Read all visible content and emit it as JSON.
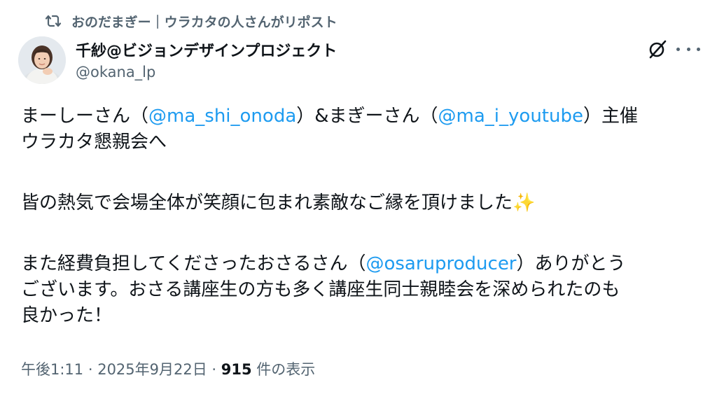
{
  "repost": {
    "text": "おのだまぎー｜ウラカタの人さんがリポスト"
  },
  "author": {
    "display_name": "千紗@ビジョンデザインプロジェクト",
    "handle": "@okana_lp"
  },
  "body": {
    "l1a": "まーしーさん（",
    "l1_mention1": "@ma_shi_onoda",
    "l1b": "）&まぎーさん（",
    "l1_mention2": "@ma_i_youtube",
    "l1c": "）主催",
    "l2": "ウラカタ懇親会へ",
    "l3": "皆の熱気で会場全体が笑顔に包まれ素敵なご縁を頂けました✨",
    "l4a": "また経費負担してくださったおさるさん（",
    "l4_mention": "@osaruproducer",
    "l4b": "）ありがとう",
    "l5": "ございます。おさる講座生の方も多く講座生同士親睦会を深められたのも",
    "l6": "良かった！"
  },
  "meta": {
    "time": "午後1:11",
    "sep1": " · ",
    "date": "2025年9月22日",
    "sep2": " · ",
    "views": "915",
    "views_label": " 件の表示"
  },
  "colors": {
    "mention": "#1d9bf0",
    "secondary": "#536471",
    "primary_text": "#0f1419"
  },
  "icons": {
    "repost": "repost-icon",
    "grok": "grok-icon",
    "more": "more-icon"
  }
}
